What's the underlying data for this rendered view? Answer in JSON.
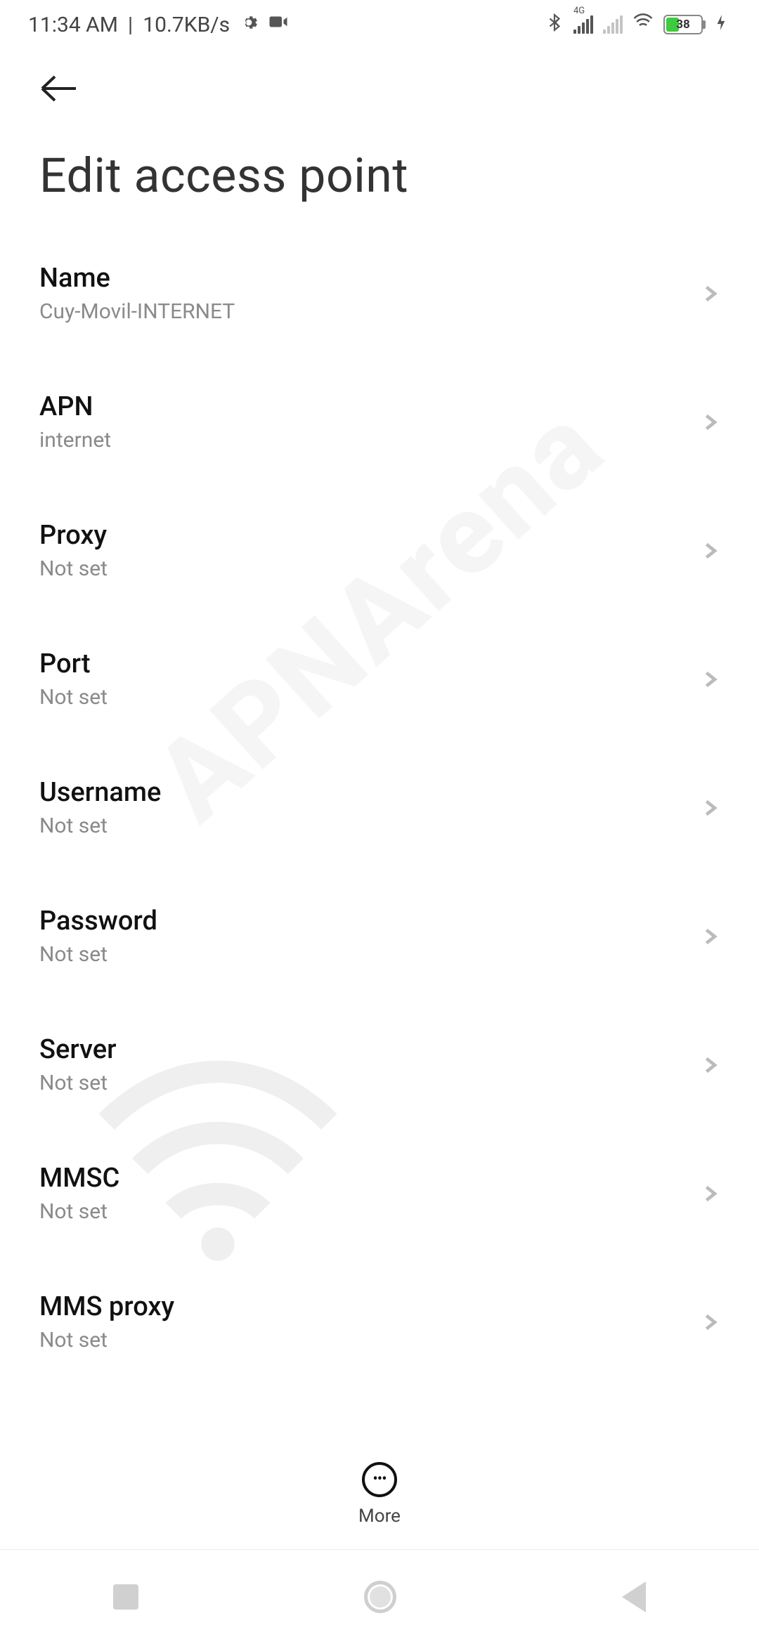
{
  "status": {
    "time": "11:34 AM",
    "net_speed": "10.7KB/s",
    "network_label_4g": "4G",
    "battery_percent": "38"
  },
  "header": {
    "title": "Edit access point"
  },
  "fields": [
    {
      "label": "Name",
      "value": "Cuy-Movil-INTERNET"
    },
    {
      "label": "APN",
      "value": "internet"
    },
    {
      "label": "Proxy",
      "value": "Not set"
    },
    {
      "label": "Port",
      "value": "Not set"
    },
    {
      "label": "Username",
      "value": "Not set"
    },
    {
      "label": "Password",
      "value": "Not set"
    },
    {
      "label": "Server",
      "value": "Not set"
    },
    {
      "label": "MMSC",
      "value": "Not set"
    },
    {
      "label": "MMS proxy",
      "value": "Not set"
    }
  ],
  "more_label": "More",
  "watermark": "APNArena"
}
